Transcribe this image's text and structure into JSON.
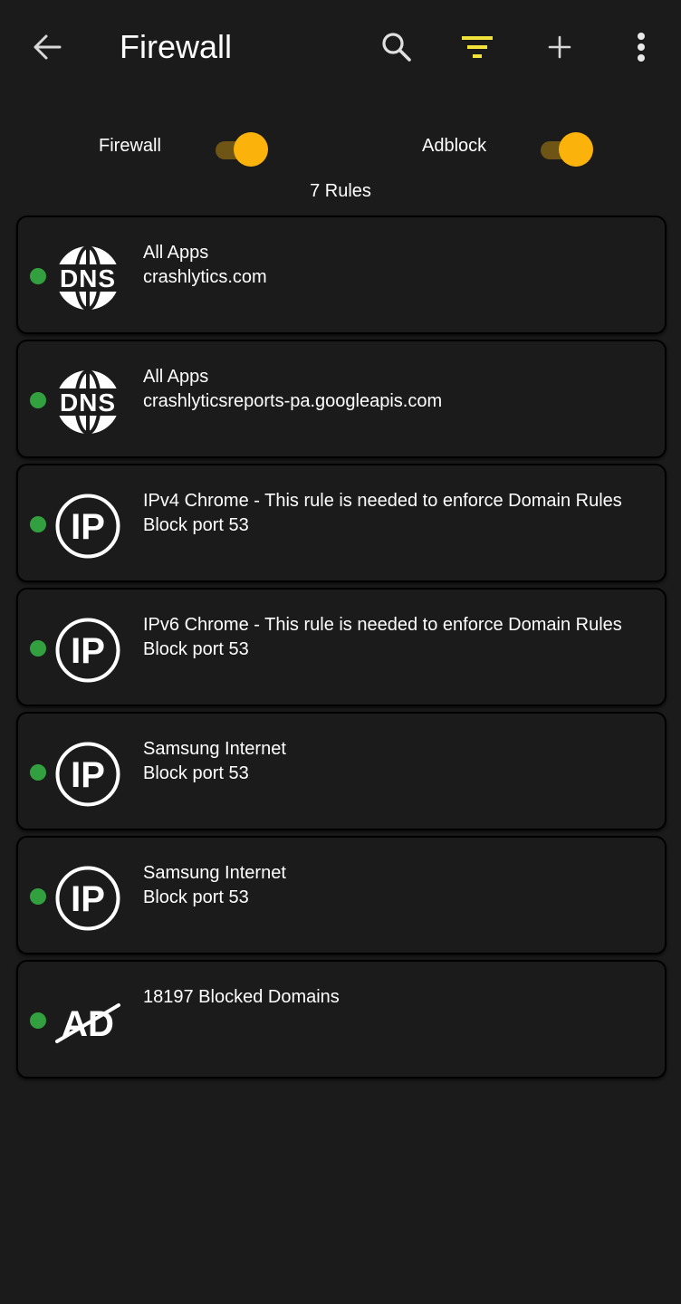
{
  "appbar": {
    "title": "Firewall",
    "back_icon": "arrow-left-icon",
    "search_icon": "search-icon",
    "filter_icon": "filter-icon",
    "add_icon": "plus-icon",
    "more_icon": "more-vertical-icon"
  },
  "colors": {
    "background": "#1b1b1b",
    "accent": "#fbb30c",
    "filter_icon": "#f2e33a",
    "status_active": "#33a040"
  },
  "toggles": {
    "firewall": {
      "label": "Firewall",
      "enabled": true
    },
    "adblock": {
      "label": "Adblock",
      "enabled": true
    }
  },
  "rules_count": "7 Rules",
  "rules": [
    {
      "icon": "dns-icon",
      "line1": "All Apps",
      "line2": "crashlytics.com",
      "active": true
    },
    {
      "icon": "dns-icon",
      "line1": "All Apps",
      "line2": "crashlyticsreports-pa.googleapis.com",
      "active": true
    },
    {
      "icon": "ip-icon",
      "line1": "IPv4 Chrome - This rule is needed to enforce Domain Rules",
      "line2": "Block port 53",
      "active": true
    },
    {
      "icon": "ip-icon",
      "line1": "IPv6 Chrome - This rule is needed to enforce Domain Rules",
      "line2": "Block port 53",
      "active": true
    },
    {
      "icon": "ip-icon",
      "line1": "Samsung Internet",
      "line2": "Block port 53",
      "active": true
    },
    {
      "icon": "ip-icon",
      "line1": "Samsung Internet",
      "line2": "Block port 53",
      "active": true
    },
    {
      "icon": "adblock-icon",
      "line1": "18197 Blocked Domains",
      "line2": "",
      "active": true
    }
  ]
}
